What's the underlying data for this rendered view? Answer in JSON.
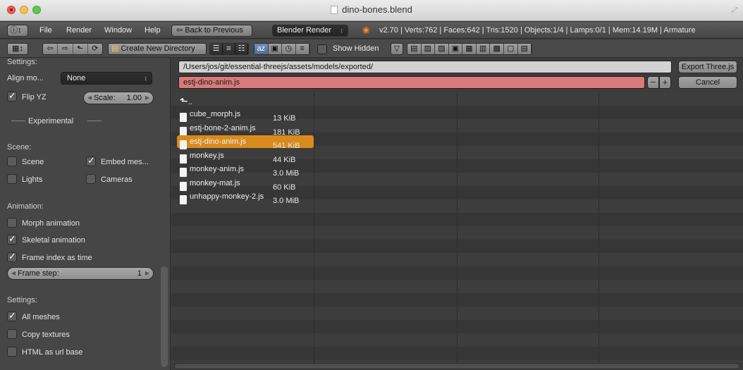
{
  "window": {
    "title": "dino-bones.blend"
  },
  "infobar": {
    "menus": [
      "File",
      "Render",
      "Window",
      "Help"
    ],
    "back_button": "Back to Previous",
    "render_engine": "Blender Render",
    "stats": "v2.70 | Verts:762 | Faces:642 | Tris:1520 | Objects:1/4 | Lamps:0/1 | Mem:14.19M | Armature"
  },
  "toolbar": {
    "new_directory": "Create New Directory",
    "show_hidden_label": "Show Hidden",
    "show_hidden": false
  },
  "sidebar": {
    "settings_heading": "Settings:",
    "align_label": "Align mo...",
    "align_value": "None",
    "flip_yz_label": "Flip YZ",
    "flip_yz": true,
    "scale_label": "Scale:",
    "scale_value": "1.00",
    "experimental_label": "Experimental",
    "scene_heading": "Scene:",
    "scene_label": "Scene",
    "scene": false,
    "embed_label": "Embed mes...",
    "embed": true,
    "lights_label": "Lights",
    "lights": false,
    "cameras_label": "Cameras",
    "cameras": false,
    "animation_heading": "Animation:",
    "morph_label": "Morph animation",
    "morph": false,
    "skeletal_label": "Skeletal animation",
    "skeletal": true,
    "frame_index_label": "Frame index as time",
    "frame_index": true,
    "frame_step_label": "Frame step:",
    "frame_step_value": "1",
    "settings2_heading": "Settings:",
    "all_meshes_label": "All meshes",
    "all_meshes": true,
    "copy_textures_label": "Copy textures",
    "copy_textures": false,
    "html_url_label": "HTML as url base",
    "html_url": false
  },
  "browser": {
    "path": "/Users/jos/git/essential-threejs/assets/models/exported/",
    "filename": "estj-dino-anim.js",
    "export_button": "Export Three.js",
    "cancel_button": "Cancel",
    "parent_label": "..",
    "files": [
      {
        "name": "cube_morph.js",
        "size": "13 KiB",
        "selected": false
      },
      {
        "name": "estj-bone-2-anim.js",
        "size": "181 KiB",
        "selected": false
      },
      {
        "name": "estj-dino-anim.js",
        "size": "541 KiB",
        "selected": true
      },
      {
        "name": "monkey.js",
        "size": "44 KiB",
        "selected": false
      },
      {
        "name": "monkey-anim.js",
        "size": "3.0 MiB",
        "selected": false
      },
      {
        "name": "monkey-mat.js",
        "size": "60 KiB",
        "selected": false
      },
      {
        "name": "unhappy-monkey-2.js",
        "size": "3.0 MiB",
        "selected": false
      }
    ]
  }
}
